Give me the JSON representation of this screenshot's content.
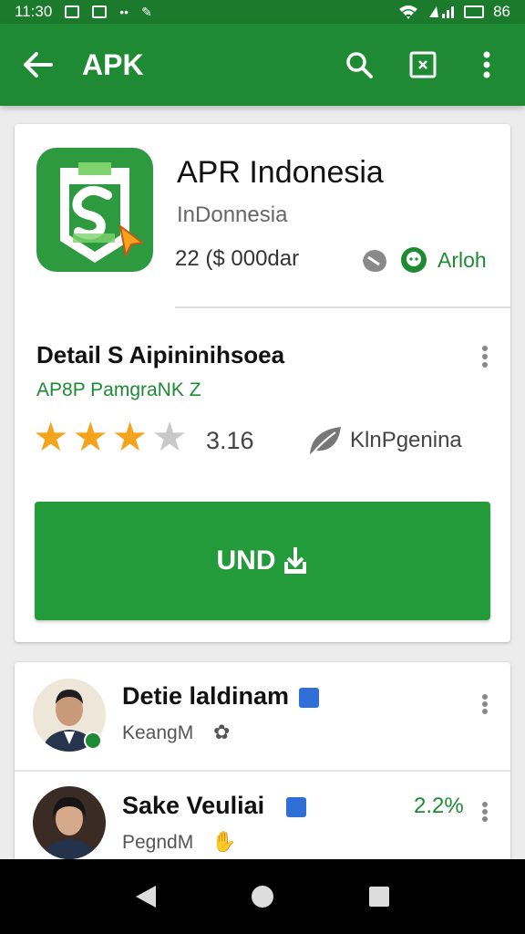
{
  "status_bar": {
    "time": "11:30",
    "battery": "86"
  },
  "app_bar": {
    "title": "APK",
    "icons": [
      "back-arrow-icon",
      "search-icon",
      "close-box-icon",
      "more-vert-icon"
    ]
  },
  "app": {
    "name": "APR Indonesia",
    "subtitle": "InDonnesia",
    "price": "22 ($ 000dar",
    "meta_label": "Arloh"
  },
  "detail": {
    "title": "Detail S Aipininihsoea",
    "subtitle": "AP8P PamgraNK Z",
    "rating": "3.16",
    "stars_filled": 3,
    "stars_total": 4,
    "category": "KlnPgenina",
    "install_label": "UND"
  },
  "reviews": [
    {
      "name": "Detie laldinam",
      "sub": "KeangM",
      "sub_icon": "flower-icon"
    },
    {
      "name": "Sake Veuliai",
      "sub": "PegndM",
      "sub_icon": "hand-icon",
      "percent": "2.2%"
    }
  ],
  "colors": {
    "primary": "#1f8a34",
    "primary_dark": "#1b7a2c",
    "button": "#239b3a",
    "star": "#f3a41c",
    "star_off": "#c8c8c8"
  }
}
